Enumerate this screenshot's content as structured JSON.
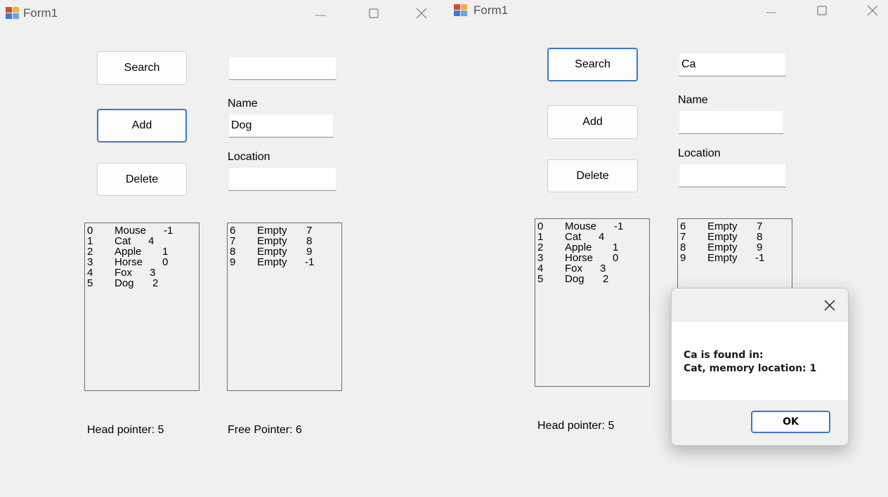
{
  "window1": {
    "title": "Form1",
    "buttons": {
      "search": "Search",
      "add": "Add",
      "delete": "Delete"
    },
    "search_value": "",
    "name_label": "Name",
    "name_value": "Dog",
    "location_label": "Location",
    "location_value": "",
    "list_left": [
      {
        "index": "0",
        "name": "Mouse",
        "ptr": "-1"
      },
      {
        "index": "1",
        "name": "Cat",
        "ptr": "4"
      },
      {
        "index": "2",
        "name": "Apple",
        "ptr": "1"
      },
      {
        "index": "3",
        "name": "Horse",
        "ptr": "0"
      },
      {
        "index": "4",
        "name": "Fox",
        "ptr": "3"
      },
      {
        "index": "5",
        "name": "Dog",
        "ptr": "2"
      }
    ],
    "list_right": [
      {
        "index": "6",
        "name": "Empty",
        "ptr": "7"
      },
      {
        "index": "7",
        "name": "Empty",
        "ptr": "8"
      },
      {
        "index": "8",
        "name": "Empty",
        "ptr": "9"
      },
      {
        "index": "9",
        "name": "Empty",
        "ptr": "-1"
      }
    ],
    "head_pointer": "Head pointer: 5",
    "free_pointer": "Free Pointer: 6"
  },
  "window2": {
    "title": "Form1",
    "buttons": {
      "search": "Search",
      "add": "Add",
      "delete": "Delete"
    },
    "search_value": "Ca",
    "name_label": "Name",
    "name_value": "",
    "location_label": "Location",
    "location_value": "",
    "list_left": [
      {
        "index": "0",
        "name": "Mouse",
        "ptr": "-1"
      },
      {
        "index": "1",
        "name": "Cat",
        "ptr": "4"
      },
      {
        "index": "2",
        "name": "Apple",
        "ptr": "1"
      },
      {
        "index": "3",
        "name": "Horse",
        "ptr": "0"
      },
      {
        "index": "4",
        "name": "Fox",
        "ptr": "3"
      },
      {
        "index": "5",
        "name": "Dog",
        "ptr": "2"
      }
    ],
    "list_right": [
      {
        "index": "6",
        "name": "Empty",
        "ptr": "7"
      },
      {
        "index": "7",
        "name": "Empty",
        "ptr": "8"
      },
      {
        "index": "8",
        "name": "Empty",
        "ptr": "9"
      },
      {
        "index": "9",
        "name": "Empty",
        "ptr": "-1"
      }
    ],
    "head_pointer": "Head pointer: 5"
  },
  "dialog": {
    "line1": "Ca is found in:",
    "line2": "Cat, memory location: 1",
    "ok_label": "OK"
  },
  "icons": {
    "app": "windows-form-icon",
    "minimize": "minimize-icon",
    "maximize": "maximize-icon",
    "close": "close-icon"
  }
}
